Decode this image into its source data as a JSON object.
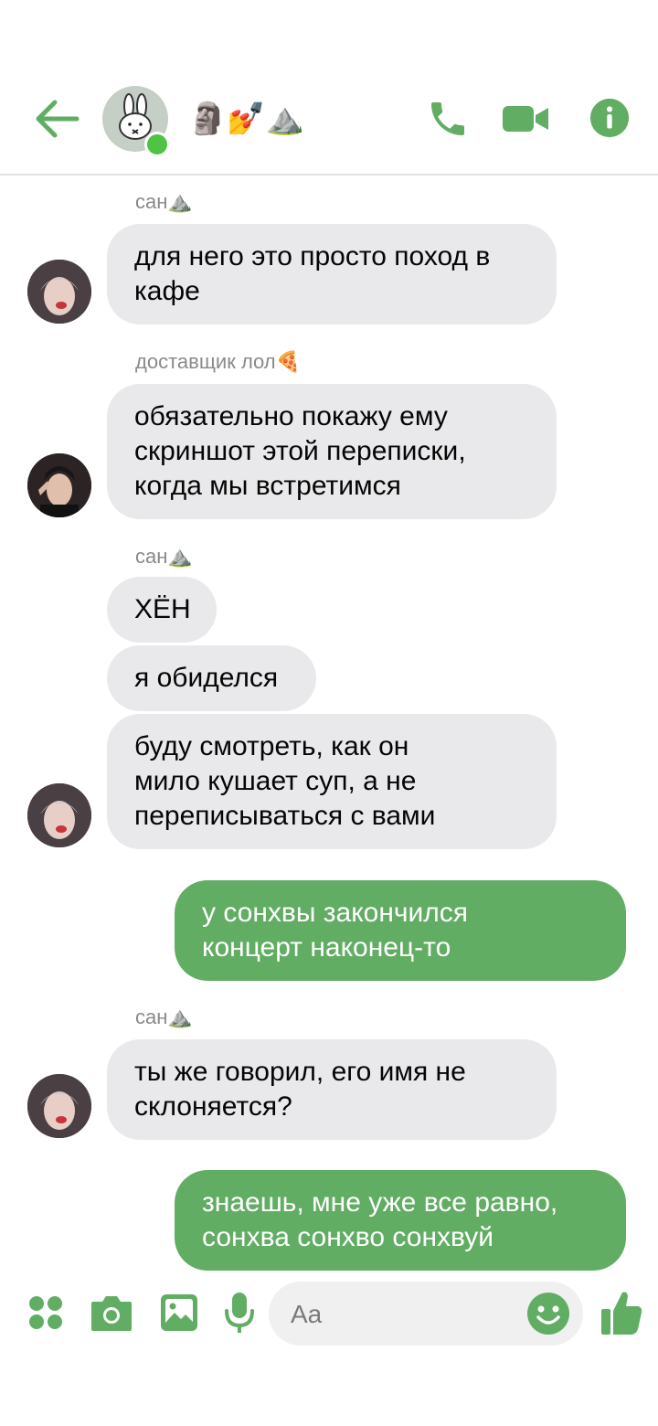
{
  "header": {
    "title": "🗿💅⛰️",
    "icons": {
      "back": "arrow-left-icon",
      "call": "phone-icon",
      "video": "video-camera-icon",
      "info": "info-icon"
    },
    "accent_color": "#62ad64"
  },
  "messages": [
    {
      "sender": "сан⛰️",
      "text": "для него это просто поход в\nкафе"
    },
    {
      "sender": "доставщик лол🍕",
      "text": "обязательно покажу ему\nскриншот этой переписки,\nкогда мы встретимся"
    },
    {
      "sender": "сан⛰️",
      "texts": [
        "ХЁН",
        "я обиделся",
        "буду смотреть, как он\nмило кушает суп, а не\nпереписываться с вами"
      ]
    },
    {
      "outgoing": true,
      "text": "у сонхвы закончился\nконцерт наконец-то"
    },
    {
      "sender": "сан⛰️",
      "text": "ты же говорил, его имя не\nсклоняется?"
    },
    {
      "outgoing": true,
      "text": "знаешь, мне уже все равно,\nсонхва сонхво сонхвуй"
    }
  ],
  "composer": {
    "placeholder": "Aa",
    "icons": [
      "apps-icon",
      "camera-icon",
      "gallery-icon",
      "microphone-icon",
      "emoji-icon",
      "thumbs-up-icon"
    ]
  }
}
